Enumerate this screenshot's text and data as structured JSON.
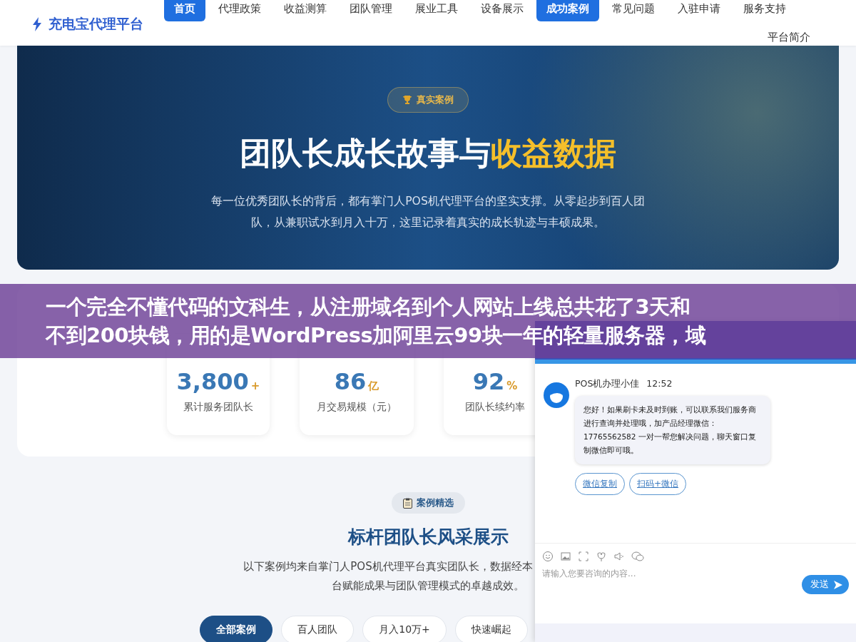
{
  "header": {
    "logo": "充电宝代理平台",
    "nav": [
      {
        "label": "首页",
        "selected": true
      },
      {
        "label": "代理政策",
        "selected": false
      },
      {
        "label": "收益测算",
        "selected": false
      },
      {
        "label": "团队管理",
        "selected": false
      },
      {
        "label": "展业工具",
        "selected": false
      },
      {
        "label": "设备展示",
        "selected": false
      },
      {
        "label": "成功案例",
        "selected": true
      },
      {
        "label": "常见问题",
        "selected": false
      },
      {
        "label": "入驻申请",
        "selected": false
      },
      {
        "label": "服务支持",
        "selected": false
      },
      {
        "label": "平台简介",
        "selected": false
      }
    ]
  },
  "hero": {
    "badge": "真实案例",
    "title_main": "团队长成长故事与",
    "title_highlight": "收益数据",
    "subtitle": "每一位优秀团队长的背后，都有掌门人POS机代理平台的坚实支撑。从零起步到百人团队，从兼职试水到月入十万，这里记录着真实的成长轨迹与丰硕成果。"
  },
  "stats": [
    {
      "value": "3,800",
      "unit": "+",
      "label": "累计服务团队长"
    },
    {
      "value": "86",
      "unit": "亿",
      "label": "月交易规模（元）"
    },
    {
      "value": "92",
      "unit": "%",
      "label": "团队长续约率"
    }
  ],
  "showcase": {
    "badge": "案例精选",
    "title": "标杆团队长风采展示",
    "description_lines": [
      "以下案例均来自掌门人POS机代理平台真实团队长，数据经本",
      "台赋能成果与团队管理模式的卓越成效。"
    ],
    "filters": [
      {
        "label": "全部案例",
        "selected": true
      },
      {
        "label": "百人团队",
        "selected": false
      },
      {
        "label": "月入10万+",
        "selected": false
      },
      {
        "label": "快速崛起",
        "selected": false
      }
    ]
  },
  "banner": {
    "lines": [
      "一个完全不懂代码的文科生，从注册域名到个人网站上线总共花了3天和",
      "不到200块钱，用的是WordPress加阿里云99块一年的轻量服务器，域"
    ]
  },
  "chat": {
    "agent": "POS机办理小佳",
    "time": "12:52",
    "message": "您好！如果刷卡未及时到账，可以联系我们服务商进行查询并处理哦，加产品经理微信：17765562582 一对一帮您解决问题，聊天窗口复制微信即可哦。",
    "actions": [
      "微信复制",
      "扫码+微信"
    ],
    "input_placeholder": "请输入您要咨询的内容...",
    "send": "发送"
  }
}
